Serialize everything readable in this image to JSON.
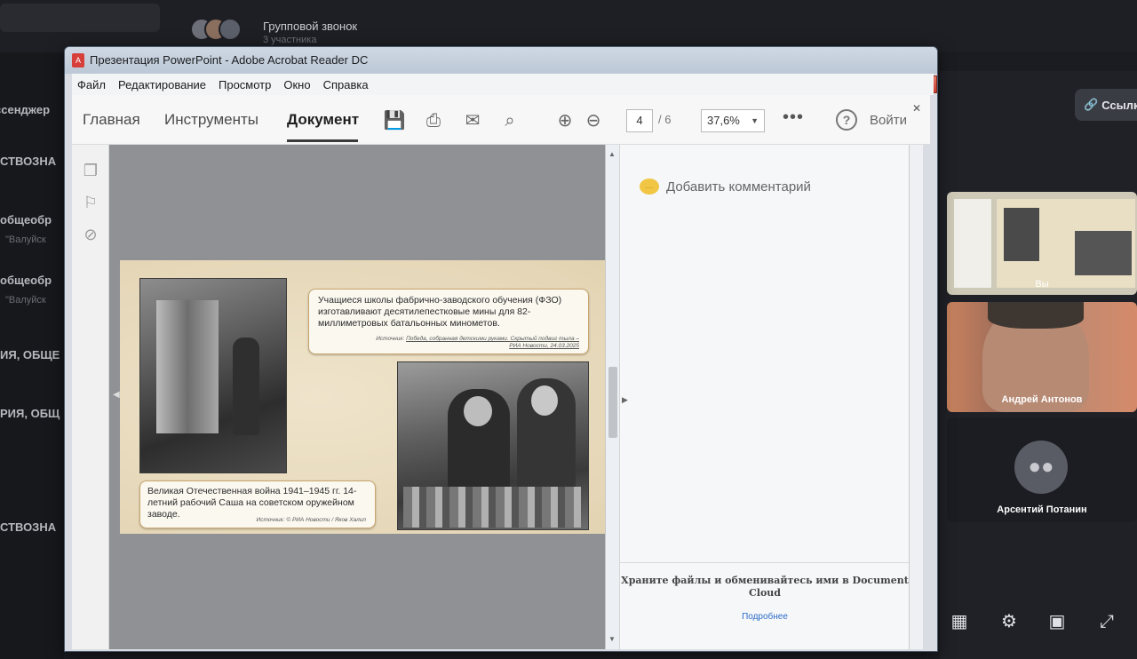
{
  "messenger": {
    "call_title": "Групповой звонок",
    "call_subtitle": "3 участника",
    "chat_items": [
      "ссенджер",
      "СТВОЗНА",
      "общеобр",
      "\"Валуйск",
      "общеобр",
      "\"Валуйск",
      "ИЯ, ОБЩЕ",
      "РИЯ, ОБЩ",
      "СТВОЗНА"
    ],
    "link_button": "Ссылка",
    "participants": [
      {
        "name": "Вы"
      },
      {
        "name": "Андрей Антонов"
      },
      {
        "name": "Арсентий Потанин"
      }
    ],
    "controls": [
      "grid-icon",
      "gear-icon",
      "screen-icon",
      "expand-icon"
    ]
  },
  "window": {
    "title": "Презентация PowerPoint - Adobe Acrobat Reader DC",
    "buttons": [
      "–",
      "□",
      "✕"
    ]
  },
  "menu": [
    "Файл",
    "Редактирование",
    "Просмотр",
    "Окно",
    "Справка"
  ],
  "toolbar": {
    "tabs": [
      "Главная",
      "Инструменты",
      "Документ"
    ],
    "active_tab": "Документ",
    "page_current": "4",
    "page_total": "/ 6",
    "zoom": "37,6%",
    "login": "Войти",
    "more": "•••",
    "help": "?"
  },
  "slide": {
    "callout1_text": "Учащиеся школы фабрично-заводского обучения (ФЗО) изготавливают десятилепестковые мины для 82-миллиметровых батальонных минометов.",
    "callout1_source_prefix": "Источник: ",
    "callout1_source": "Победа, собранная детскими руками. Скрытый подвиг тыла – РИА Новости, 24.03.2025",
    "callout2_text": "Великая Отечественная война 1941–1945 гг. 14-летний рабочий Саша на советском оружейном заводе.",
    "callout2_source": "Источник: © РИА Новости / Яков Халип"
  },
  "comments": {
    "add_comment": "Добавить комментарий",
    "cloud_text": "Храните файлы и обменивайтесь ими в Document Cloud",
    "more_link": "Подробнее"
  }
}
